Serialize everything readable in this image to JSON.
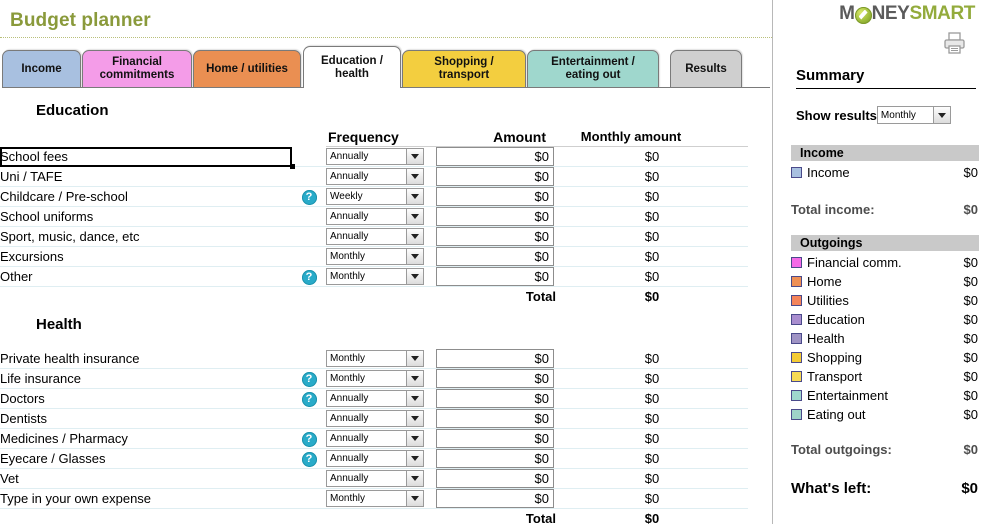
{
  "page_title": "Budget planner",
  "title_color": "#8a9a3b",
  "tabs": [
    {
      "label_top": "Income",
      "label_bottom": "",
      "color": "#a8c0e0",
      "active": false
    },
    {
      "label_top": "Financial",
      "label_bottom": "commitments",
      "color": "#f49ce8",
      "active": false
    },
    {
      "label_top": "Home / utilities",
      "label_bottom": "",
      "color": "#ea8f52",
      "active": false
    },
    {
      "label_top": "Education  /",
      "label_bottom": "health",
      "color": "#ffffff",
      "active": true
    },
    {
      "label_top": "Shopping  /",
      "label_bottom": "transport",
      "color": "#f3ce3f",
      "active": false
    },
    {
      "label_top": "Entertainment  /",
      "label_bottom": "eating out",
      "color": "#9fd7cd",
      "active": false
    },
    {
      "label_top": "Results",
      "label_bottom": "",
      "color": "#cfcfcf",
      "active": false
    }
  ],
  "columns": {
    "frequency": "Frequency",
    "amount": "Amount",
    "monthly_amount": "Monthly amount"
  },
  "total_label": "Total",
  "sections": [
    {
      "heading": "Education",
      "total": "$0",
      "rows": [
        {
          "label": "School fees",
          "help": false,
          "frequency": "Annually",
          "amount": "$0",
          "monthly": "$0",
          "selected": true
        },
        {
          "label": "Uni / TAFE",
          "help": false,
          "frequency": "Annually",
          "amount": "$0",
          "monthly": "$0",
          "selected": false
        },
        {
          "label": "Childcare / Pre-school",
          "help": true,
          "frequency": "Weekly",
          "amount": "$0",
          "monthly": "$0",
          "selected": false
        },
        {
          "label": "School uniforms",
          "help": false,
          "frequency": "Annually",
          "amount": "$0",
          "monthly": "$0",
          "selected": false
        },
        {
          "label": "Sport, music, dance, etc",
          "help": false,
          "frequency": "Annually",
          "amount": "$0",
          "monthly": "$0",
          "selected": false
        },
        {
          "label": "Excursions",
          "help": false,
          "frequency": "Monthly",
          "amount": "$0",
          "monthly": "$0",
          "selected": false
        },
        {
          "label": "Other",
          "help": true,
          "frequency": "Monthly",
          "amount": "$0",
          "monthly": "$0",
          "selected": false
        }
      ]
    },
    {
      "heading": "Health",
      "total": "$0",
      "rows": [
        {
          "label": "Private health insurance",
          "help": false,
          "frequency": "Monthly",
          "amount": "$0",
          "monthly": "$0",
          "selected": false
        },
        {
          "label": "Life insurance",
          "help": true,
          "frequency": "Monthly",
          "amount": "$0",
          "monthly": "$0",
          "selected": false
        },
        {
          "label": "Doctors",
          "help": true,
          "frequency": "Annually",
          "amount": "$0",
          "monthly": "$0",
          "selected": false
        },
        {
          "label": "Dentists",
          "help": false,
          "frequency": "Annually",
          "amount": "$0",
          "monthly": "$0",
          "selected": false
        },
        {
          "label": "Medicines / Pharmacy",
          "help": true,
          "frequency": "Annually",
          "amount": "$0",
          "monthly": "$0",
          "selected": false
        },
        {
          "label": "Eyecare / Glasses",
          "help": true,
          "frequency": "Annually",
          "amount": "$0",
          "monthly": "$0",
          "selected": false
        },
        {
          "label": "Vet",
          "help": false,
          "frequency": "Annually",
          "amount": "$0",
          "monthly": "$0",
          "selected": false
        },
        {
          "label": "Type in your own expense",
          "help": false,
          "frequency": "Monthly",
          "amount": "$0",
          "monthly": "$0",
          "selected": false
        }
      ]
    }
  ],
  "sidebar": {
    "logo": {
      "money": "M",
      "globe": "globe-icon",
      "money_rest": "NEY",
      "smart": "SMART"
    },
    "print_icon": "printer-icon",
    "summary_title": "Summary",
    "show_results_label": "Show results",
    "show_results_value": "Monthly",
    "income_band": "Income",
    "income_rows": [
      {
        "label": "Income",
        "value": "$0",
        "color": "#a8c0e0"
      }
    ],
    "total_income_label": "Total income:",
    "total_income_value": "$0",
    "outgoings_band": "Outgoings",
    "outgoing_rows": [
      {
        "label": "Financial comm.",
        "value": "$0",
        "color": "#f46ae8"
      },
      {
        "label": "Home",
        "value": "$0",
        "color": "#ef9055"
      },
      {
        "label": "Utilities",
        "value": "$0",
        "color": "#f4845a"
      },
      {
        "label": "Education",
        "value": "$0",
        "color": "#a98dcf"
      },
      {
        "label": "Health",
        "value": "$0",
        "color": "#9f93c4"
      },
      {
        "label": "Shopping",
        "value": "$0",
        "color": "#f3cb36"
      },
      {
        "label": "Transport",
        "value": "$0",
        "color": "#f7da55"
      },
      {
        "label": "Entertainment",
        "value": "$0",
        "color": "#9fd7cd"
      },
      {
        "label": "Eating out",
        "value": "$0",
        "color": "#9ed3c8"
      }
    ],
    "total_outgoings_label": "Total outgoings:",
    "total_outgoings_value": "$0",
    "whats_left_label": "What's left:",
    "whats_left_value": "$0"
  }
}
